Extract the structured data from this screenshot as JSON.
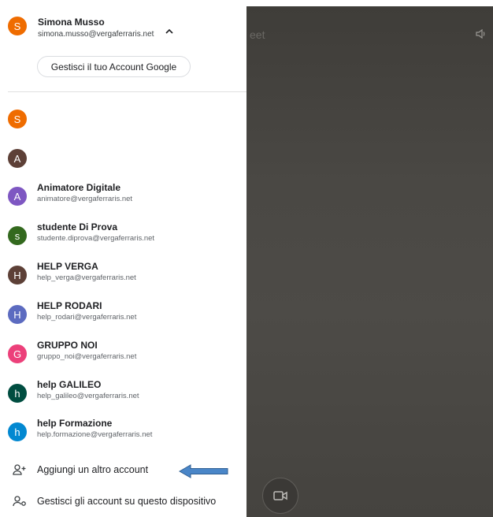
{
  "current_account": {
    "initial": "S",
    "name": "Simona Musso",
    "email": "simona.musso@vergaferraris.net",
    "color": "#ef6c00"
  },
  "manage_button_label": "Gestisci il tuo Account Google",
  "accounts": [
    {
      "initial": "S",
      "name": "",
      "email": "",
      "color": "#ef6c00"
    },
    {
      "initial": "A",
      "name": "",
      "email": "",
      "color": "#5d4037"
    },
    {
      "initial": "A",
      "name": "Animatore Digitale",
      "email": "animatore@vergaferraris.net",
      "color": "#7e57c2"
    },
    {
      "initial": "s",
      "name": "studente Di Prova",
      "email": "studente.diprova@vergaferraris.net",
      "color": "#33691e"
    },
    {
      "initial": "H",
      "name": "HELP VERGA",
      "email": "help_verga@vergaferraris.net",
      "color": "#5d4037"
    },
    {
      "initial": "H",
      "name": "HELP RODARI",
      "email": "help_rodari@vergaferraris.net",
      "color": "#5c6bc0"
    },
    {
      "initial": "G",
      "name": "GRUPPO NOI",
      "email": "gruppo_noi@vergaferraris.net",
      "color": "#ec407a"
    },
    {
      "initial": "h",
      "name": "help GALILEO",
      "email": "help_galileo@vergaferraris.net",
      "color": "#004d40"
    },
    {
      "initial": "h",
      "name": "help Formazione",
      "email": "help.formazione@vergaferraris.net",
      "color": "#0288d1"
    }
  ],
  "actions": {
    "add_account": {
      "label": "Aggiungi un altro account",
      "icon": "person-add-icon"
    },
    "manage_device": {
      "label": "Gestisci gli account su questo dispositivo",
      "icon": "manage-accounts-icon"
    }
  },
  "background": {
    "partial_text": "eet"
  },
  "colors": {
    "arrow": "#4a86c8"
  }
}
